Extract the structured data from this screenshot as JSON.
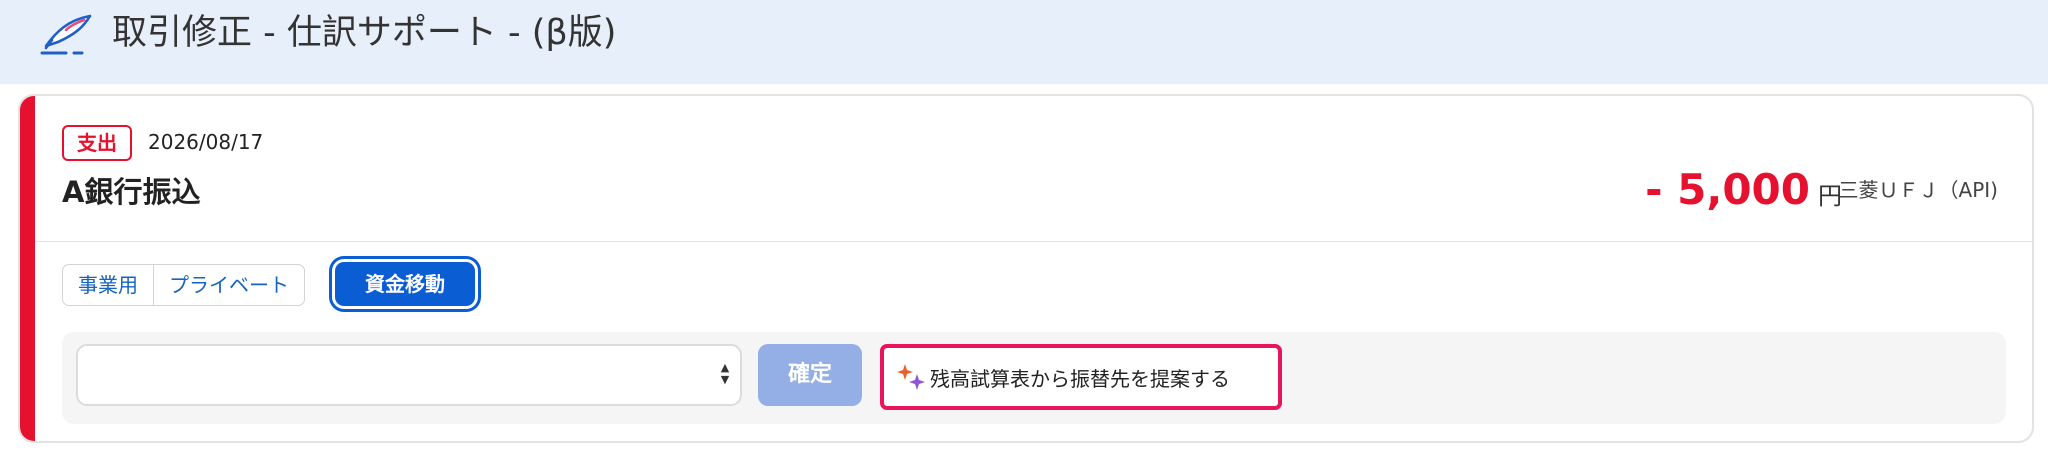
{
  "header": {
    "title": "取引修正 - 仕訳サポート - (β版)",
    "icon": "feather-pen-icon"
  },
  "transaction": {
    "type_badge": "支出",
    "date": "2026/08/17",
    "title": "A銀行振込",
    "amount": "- 5,000",
    "currency": "円",
    "account": "三菱ＵＦＪ（API)"
  },
  "category_tabs": {
    "items": [
      "事業用",
      "プライベート"
    ],
    "selected_button": "資金移動"
  },
  "action_panel": {
    "select_value": "",
    "confirm_label": "確定",
    "suggest_label": "残高試算表から振替先を提案する",
    "suggest_icon": "sparkle-icon"
  },
  "colors": {
    "accent_red": "#e6112e",
    "primary_blue": "#0a5dd3",
    "disabled_blue": "#93afe6",
    "highlight_pink": "#e8155a",
    "header_bg": "#e7effa"
  }
}
